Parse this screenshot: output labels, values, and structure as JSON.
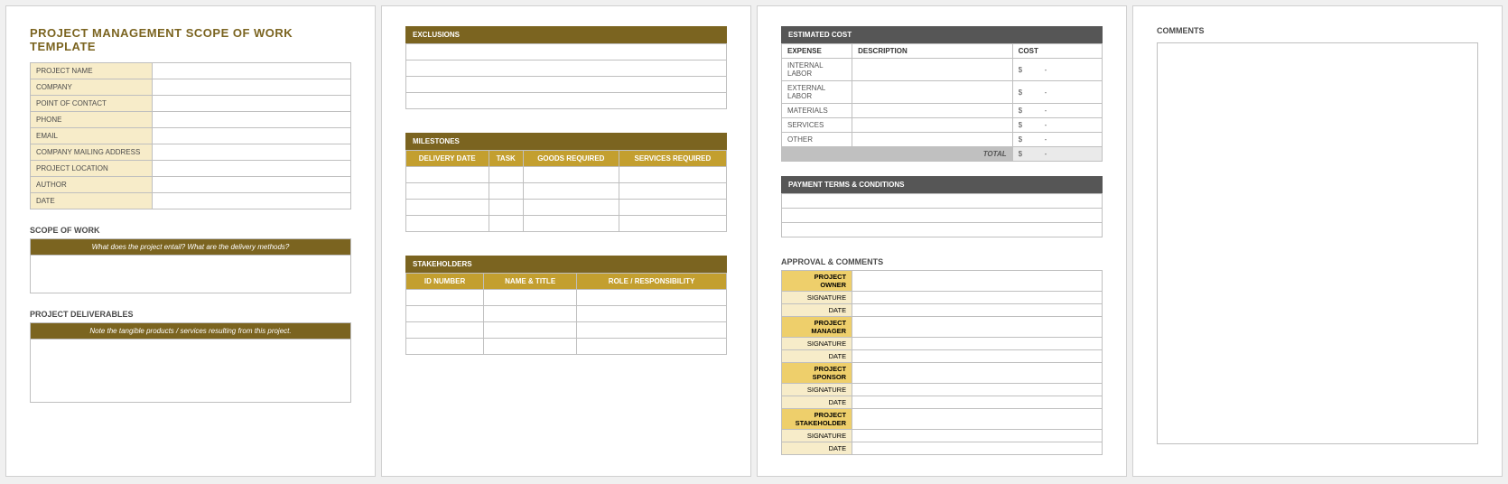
{
  "page1": {
    "title": "PROJECT MANAGEMENT SCOPE OF WORK TEMPLATE",
    "fields": [
      "PROJECT NAME",
      "COMPANY",
      "POINT OF CONTACT",
      "PHONE",
      "EMAIL",
      "COMPANY MAILING ADDRESS",
      "PROJECT LOCATION",
      "AUTHOR",
      "DATE"
    ],
    "scope_heading": "SCOPE OF WORK",
    "scope_banner": "What does the project entail? What are the delivery methods?",
    "deliv_heading": "PROJECT DELIVERABLES",
    "deliv_banner": "Note the tangible products / services resulting from this project."
  },
  "page2": {
    "exclusions_title": "EXCLUSIONS",
    "milestones_title": "MILESTONES",
    "milestones_cols": [
      "DELIVERY DATE",
      "TASK",
      "GOODS REQUIRED",
      "SERVICES REQUIRED"
    ],
    "stakeholders_title": "STAKEHOLDERS",
    "stakeholders_cols": [
      "ID NUMBER",
      "NAME & TITLE",
      "ROLE / RESPONSIBILITY"
    ]
  },
  "page3": {
    "cost_title": "ESTIMATED COST",
    "cost_cols": [
      "EXPENSE",
      "DESCRIPTION",
      "COST"
    ],
    "cost_rows": [
      {
        "expense": "INTERNAL LABOR",
        "cost_sym": "$",
        "cost_val": "-"
      },
      {
        "expense": "EXTERNAL LABOR",
        "cost_sym": "$",
        "cost_val": "-"
      },
      {
        "expense": "MATERIALS",
        "cost_sym": "$",
        "cost_val": "-"
      },
      {
        "expense": "SERVICES",
        "cost_sym": "$",
        "cost_val": "-"
      },
      {
        "expense": "OTHER",
        "cost_sym": "$",
        "cost_val": "-"
      }
    ],
    "total_label": "TOTAL",
    "total_sym": "$",
    "total_val": "-",
    "pay_title": "PAYMENT TERMS & CONDITIONS",
    "approval_heading": "APPROVAL & COMMENTS",
    "approval_groups": [
      {
        "head": "PROJECT OWNER",
        "sig": "SIGNATURE",
        "date": "DATE"
      },
      {
        "head": "PROJECT MANAGER",
        "sig": "SIGNATURE",
        "date": "DATE"
      },
      {
        "head": "PROJECT SPONSOR",
        "sig": "SIGNATURE",
        "date": "DATE"
      },
      {
        "head": "PROJECT STAKEHOLDER",
        "sig": "SIGNATURE",
        "date": "DATE"
      }
    ]
  },
  "page4": {
    "comments_heading": "COMMENTS"
  }
}
